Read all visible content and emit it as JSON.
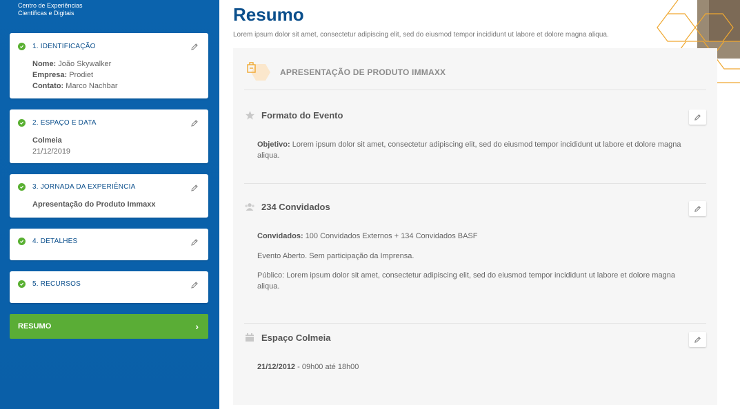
{
  "brand": {
    "line1": "Centro de Experiências",
    "line2": "Científicas e Digitais"
  },
  "steps": [
    {
      "title": "1. IDENTIFICAÇÃO",
      "fields": [
        {
          "label": "Nome:",
          "value": "João Skywalker"
        },
        {
          "label": "Empresa:",
          "value": "Prodiet"
        },
        {
          "label": "Contato:",
          "value": "Marco Nachbar"
        }
      ]
    },
    {
      "title": "2. ESPAÇO E DATA",
      "name": "Colmeia",
      "date": "21/12/2019"
    },
    {
      "title": "3. JORNADA DA EXPERIÊNCIA",
      "name": "Apresentação do Produto Immaxx"
    },
    {
      "title": "4. DETALHES"
    },
    {
      "title": "5. RECURSOS"
    }
  ],
  "summary_button": {
    "label": "RESUMO"
  },
  "main": {
    "title": "Resumo",
    "subtitle": "Lorem ipsum dolor sit amet, consectetur adipiscing elit, sed do eiusmod tempor incididunt ut labore et dolore magna aliqua."
  },
  "product": {
    "title": "APRESENTAÇÃO DE PRODUTO IMMAXX"
  },
  "sections": {
    "formato": {
      "title": "Formato do Evento",
      "objective_label": "Objetivo:",
      "objective_text": "Lorem ipsum dolor sit amet, consectetur adipiscing elit, sed do eiusmod tempor incididunt ut labore et dolore magna aliqua."
    },
    "convidados": {
      "title": "234 Convidados",
      "guests_label": "Convidados:",
      "guests_text": "100 Convidados Externos + 134 Convidados BASF",
      "event_text": "Evento Aberto. Sem participação da Imprensa.",
      "public_text": "Público: Lorem ipsum dolor sit amet, consectetur adipiscing elit, sed do eiusmod tempor incididunt ut labore et dolore magna aliqua."
    },
    "espaco": {
      "title": "Espaço Colmeia",
      "date_label": "21/12/2012",
      "time_text": " - 09h00 até 18h00"
    }
  },
  "colors": {
    "sidebar": "#0b63ad",
    "accent_green": "#5aad36",
    "title_blue": "#0b4f8c",
    "honeycomb": "#f0a830"
  }
}
